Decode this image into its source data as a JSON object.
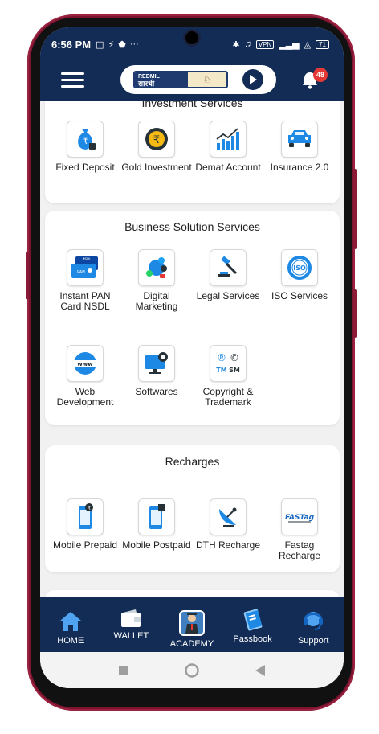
{
  "status_bar": {
    "time": "6:56 PM",
    "more": "···",
    "vpn": "VPN",
    "battery": "71"
  },
  "header": {
    "logo_brand": "REDMIL",
    "logo_name": "सारथी",
    "notification_count": "48"
  },
  "investment": {
    "title": "Investment Services",
    "items": [
      {
        "label": "Fixed Deposit",
        "icon": "money-bag-icon"
      },
      {
        "label": "Gold Investment",
        "icon": "gold-coin-icon"
      },
      {
        "label": "Demat Account",
        "icon": "bar-chart-icon"
      },
      {
        "label": "Insurance 2.0",
        "icon": "car-icon"
      }
    ]
  },
  "business": {
    "title": "Business Solution Services",
    "items": [
      {
        "label": "Instant PAN Card NSDL",
        "icon": "pan-card-icon"
      },
      {
        "label": "Digital Marketing",
        "icon": "social-media-icon"
      },
      {
        "label": "Legal Services",
        "icon": "gavel-icon"
      },
      {
        "label": "ISO Services",
        "icon": "iso-badge-icon"
      },
      {
        "label": "Web Development",
        "icon": "www-globe-icon"
      },
      {
        "label": "Softwares",
        "icon": "monitor-gear-icon"
      },
      {
        "label": "Copyright & Trademark",
        "icon": "copyright-trademark-icon"
      }
    ],
    "icon_texts": {
      "nsdl": "NSDL",
      "pan": "PAN",
      "iso": "ISO",
      "www": "www",
      "tm": "TM",
      "sm": "SM",
      "r": "®",
      "c": "©"
    }
  },
  "recharges": {
    "title": "Recharges",
    "items": [
      {
        "label": "Mobile Prepaid",
        "icon": "mobile-prepaid-icon"
      },
      {
        "label": "Mobile Postpaid",
        "icon": "mobile-postpaid-icon"
      },
      {
        "label": "DTH Recharge",
        "icon": "satellite-dish-icon"
      },
      {
        "label": "Fastag Recharge",
        "icon": "fastag-icon"
      }
    ],
    "fastag_logo": "FASTag"
  },
  "bottom_nav": [
    {
      "label": "HOME",
      "icon": "home-icon"
    },
    {
      "label": "WALLET",
      "icon": "wallet-icon"
    },
    {
      "label": "ACADEMY",
      "icon": "academy-icon"
    },
    {
      "label": "Passbook",
      "icon": "passbook-icon"
    },
    {
      "label": "Support",
      "icon": "headset-icon"
    }
  ],
  "colors": {
    "header_bg": "#132c55",
    "accent_blue": "#1e88e5",
    "badge_red": "#e53935",
    "frame": "#7a1430"
  }
}
